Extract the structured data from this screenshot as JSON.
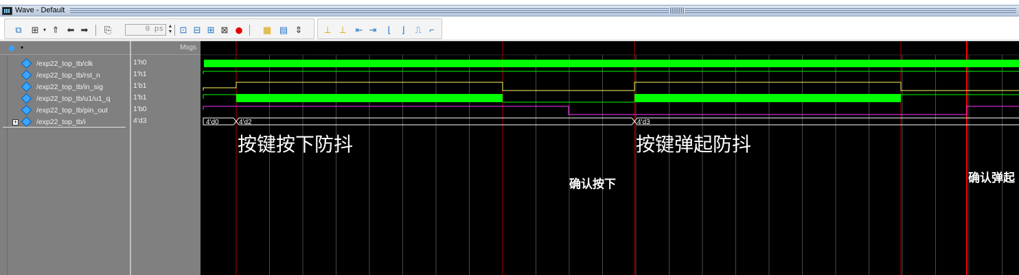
{
  "window": {
    "title": "Wave - Default"
  },
  "toolbar": {
    "time_value": "0 ps"
  },
  "header": {
    "msgs_label": "Msgs"
  },
  "signals": [
    {
      "name": "/exp22_top_tb/clk",
      "value": "1'h0"
    },
    {
      "name": "/exp22_top_tb/rst_n",
      "value": "1'h1"
    },
    {
      "name": "/exp22_top_tb/in_sig",
      "value": "1'b1"
    },
    {
      "name": "/exp22_top_tb/u1/u1_q",
      "value": "1'b1"
    },
    {
      "name": "/exp22_top_tb/pin_out",
      "value": "1'b0"
    },
    {
      "name": "/exp22_top_tb/i",
      "value": "4'd3"
    }
  ],
  "bus_labels": [
    "4'd0",
    "4'd2",
    "4'd3"
  ],
  "annotations": {
    "press_debounce": "按键按下防抖",
    "release_debounce": "按键弹起防抖",
    "confirm_press": "确认按下",
    "confirm_release": "确认弹起"
  },
  "colors": {
    "clk": "#00ff00",
    "in_sig": "#ffff66",
    "u1_q": "#00ff00",
    "pin_out": "#ff33ff",
    "rst_n": "#00ff00",
    "bus": "#ffffff",
    "cursor": "#ff0000",
    "grid": "#4a4a4a"
  }
}
